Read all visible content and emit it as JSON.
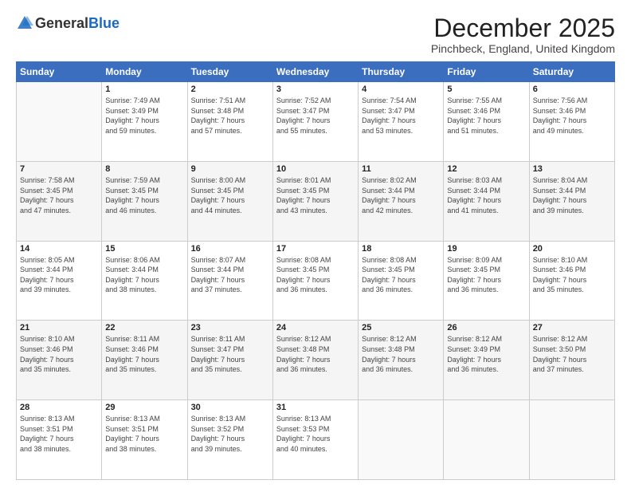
{
  "logo": {
    "general": "General",
    "blue": "Blue"
  },
  "header": {
    "month": "December 2025",
    "location": "Pinchbeck, England, United Kingdom"
  },
  "days": [
    "Sunday",
    "Monday",
    "Tuesday",
    "Wednesday",
    "Thursday",
    "Friday",
    "Saturday"
  ],
  "weeks": [
    [
      {
        "num": "",
        "info": ""
      },
      {
        "num": "1",
        "info": "Sunrise: 7:49 AM\nSunset: 3:49 PM\nDaylight: 7 hours\nand 59 minutes."
      },
      {
        "num": "2",
        "info": "Sunrise: 7:51 AM\nSunset: 3:48 PM\nDaylight: 7 hours\nand 57 minutes."
      },
      {
        "num": "3",
        "info": "Sunrise: 7:52 AM\nSunset: 3:47 PM\nDaylight: 7 hours\nand 55 minutes."
      },
      {
        "num": "4",
        "info": "Sunrise: 7:54 AM\nSunset: 3:47 PM\nDaylight: 7 hours\nand 53 minutes."
      },
      {
        "num": "5",
        "info": "Sunrise: 7:55 AM\nSunset: 3:46 PM\nDaylight: 7 hours\nand 51 minutes."
      },
      {
        "num": "6",
        "info": "Sunrise: 7:56 AM\nSunset: 3:46 PM\nDaylight: 7 hours\nand 49 minutes."
      }
    ],
    [
      {
        "num": "7",
        "info": "Sunrise: 7:58 AM\nSunset: 3:45 PM\nDaylight: 7 hours\nand 47 minutes."
      },
      {
        "num": "8",
        "info": "Sunrise: 7:59 AM\nSunset: 3:45 PM\nDaylight: 7 hours\nand 46 minutes."
      },
      {
        "num": "9",
        "info": "Sunrise: 8:00 AM\nSunset: 3:45 PM\nDaylight: 7 hours\nand 44 minutes."
      },
      {
        "num": "10",
        "info": "Sunrise: 8:01 AM\nSunset: 3:45 PM\nDaylight: 7 hours\nand 43 minutes."
      },
      {
        "num": "11",
        "info": "Sunrise: 8:02 AM\nSunset: 3:44 PM\nDaylight: 7 hours\nand 42 minutes."
      },
      {
        "num": "12",
        "info": "Sunrise: 8:03 AM\nSunset: 3:44 PM\nDaylight: 7 hours\nand 41 minutes."
      },
      {
        "num": "13",
        "info": "Sunrise: 8:04 AM\nSunset: 3:44 PM\nDaylight: 7 hours\nand 39 minutes."
      }
    ],
    [
      {
        "num": "14",
        "info": "Sunrise: 8:05 AM\nSunset: 3:44 PM\nDaylight: 7 hours\nand 39 minutes."
      },
      {
        "num": "15",
        "info": "Sunrise: 8:06 AM\nSunset: 3:44 PM\nDaylight: 7 hours\nand 38 minutes."
      },
      {
        "num": "16",
        "info": "Sunrise: 8:07 AM\nSunset: 3:44 PM\nDaylight: 7 hours\nand 37 minutes."
      },
      {
        "num": "17",
        "info": "Sunrise: 8:08 AM\nSunset: 3:45 PM\nDaylight: 7 hours\nand 36 minutes."
      },
      {
        "num": "18",
        "info": "Sunrise: 8:08 AM\nSunset: 3:45 PM\nDaylight: 7 hours\nand 36 minutes."
      },
      {
        "num": "19",
        "info": "Sunrise: 8:09 AM\nSunset: 3:45 PM\nDaylight: 7 hours\nand 36 minutes."
      },
      {
        "num": "20",
        "info": "Sunrise: 8:10 AM\nSunset: 3:46 PM\nDaylight: 7 hours\nand 35 minutes."
      }
    ],
    [
      {
        "num": "21",
        "info": "Sunrise: 8:10 AM\nSunset: 3:46 PM\nDaylight: 7 hours\nand 35 minutes."
      },
      {
        "num": "22",
        "info": "Sunrise: 8:11 AM\nSunset: 3:46 PM\nDaylight: 7 hours\nand 35 minutes."
      },
      {
        "num": "23",
        "info": "Sunrise: 8:11 AM\nSunset: 3:47 PM\nDaylight: 7 hours\nand 35 minutes."
      },
      {
        "num": "24",
        "info": "Sunrise: 8:12 AM\nSunset: 3:48 PM\nDaylight: 7 hours\nand 36 minutes."
      },
      {
        "num": "25",
        "info": "Sunrise: 8:12 AM\nSunset: 3:48 PM\nDaylight: 7 hours\nand 36 minutes."
      },
      {
        "num": "26",
        "info": "Sunrise: 8:12 AM\nSunset: 3:49 PM\nDaylight: 7 hours\nand 36 minutes."
      },
      {
        "num": "27",
        "info": "Sunrise: 8:12 AM\nSunset: 3:50 PM\nDaylight: 7 hours\nand 37 minutes."
      }
    ],
    [
      {
        "num": "28",
        "info": "Sunrise: 8:13 AM\nSunset: 3:51 PM\nDaylight: 7 hours\nand 38 minutes."
      },
      {
        "num": "29",
        "info": "Sunrise: 8:13 AM\nSunset: 3:51 PM\nDaylight: 7 hours\nand 38 minutes."
      },
      {
        "num": "30",
        "info": "Sunrise: 8:13 AM\nSunset: 3:52 PM\nDaylight: 7 hours\nand 39 minutes."
      },
      {
        "num": "31",
        "info": "Sunrise: 8:13 AM\nSunset: 3:53 PM\nDaylight: 7 hours\nand 40 minutes."
      },
      {
        "num": "",
        "info": ""
      },
      {
        "num": "",
        "info": ""
      },
      {
        "num": "",
        "info": ""
      }
    ]
  ]
}
